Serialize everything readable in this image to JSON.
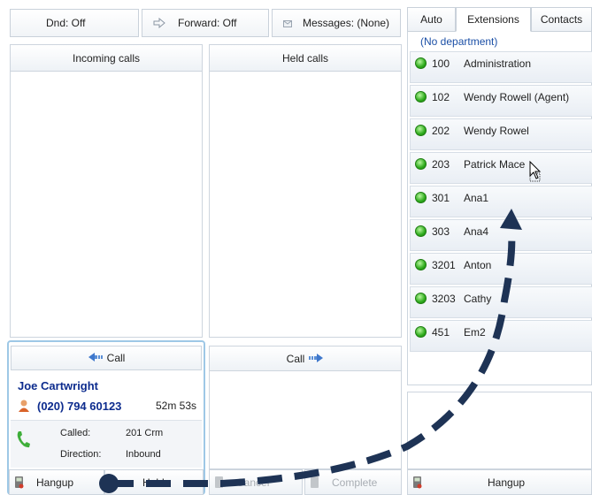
{
  "toolbar": {
    "dnd_label": "Dnd: Off",
    "forward_label": "Forward: Off",
    "messages_label": "Messages: (None)"
  },
  "panels": {
    "incoming_title": "Incoming calls",
    "held_title": "Held calls",
    "call_left_label": "Call",
    "call_right_label": "Call"
  },
  "call_card": {
    "caller_name": "Joe Cartwright",
    "caller_number": "(020) 794 60123",
    "duration": "52m 53s",
    "called_label": "Called:",
    "called_value": "201  Crm",
    "direction_label": "Direction:",
    "direction_value": "Inbound"
  },
  "bottom_buttons": {
    "hangup": "Hangup",
    "hold": "Hold",
    "cancel": "Cancel",
    "complete": "Complete",
    "right_hangup": "Hangup"
  },
  "tabs": [
    "Auto",
    "Extensions",
    "Contacts"
  ],
  "department": "(No department)",
  "extensions": [
    {
      "number": "100",
      "name": "Administration"
    },
    {
      "number": "102",
      "name": "Wendy Rowell (Agent)"
    },
    {
      "number": "202",
      "name": "Wendy Rowel"
    },
    {
      "number": "203",
      "name": "Patrick Mace"
    },
    {
      "number": "301",
      "name": "Ana1"
    },
    {
      "number": "303",
      "name": "Ana4"
    },
    {
      "number": "3201",
      "name": "Anton"
    },
    {
      "number": "3203",
      "name": "Cathy"
    },
    {
      "number": "451",
      "name": "Em2"
    }
  ],
  "colors": {
    "accent_blue": "#0d2c8e",
    "status_green": "#2eab1c",
    "annotation_arrow": "#1e3355"
  }
}
